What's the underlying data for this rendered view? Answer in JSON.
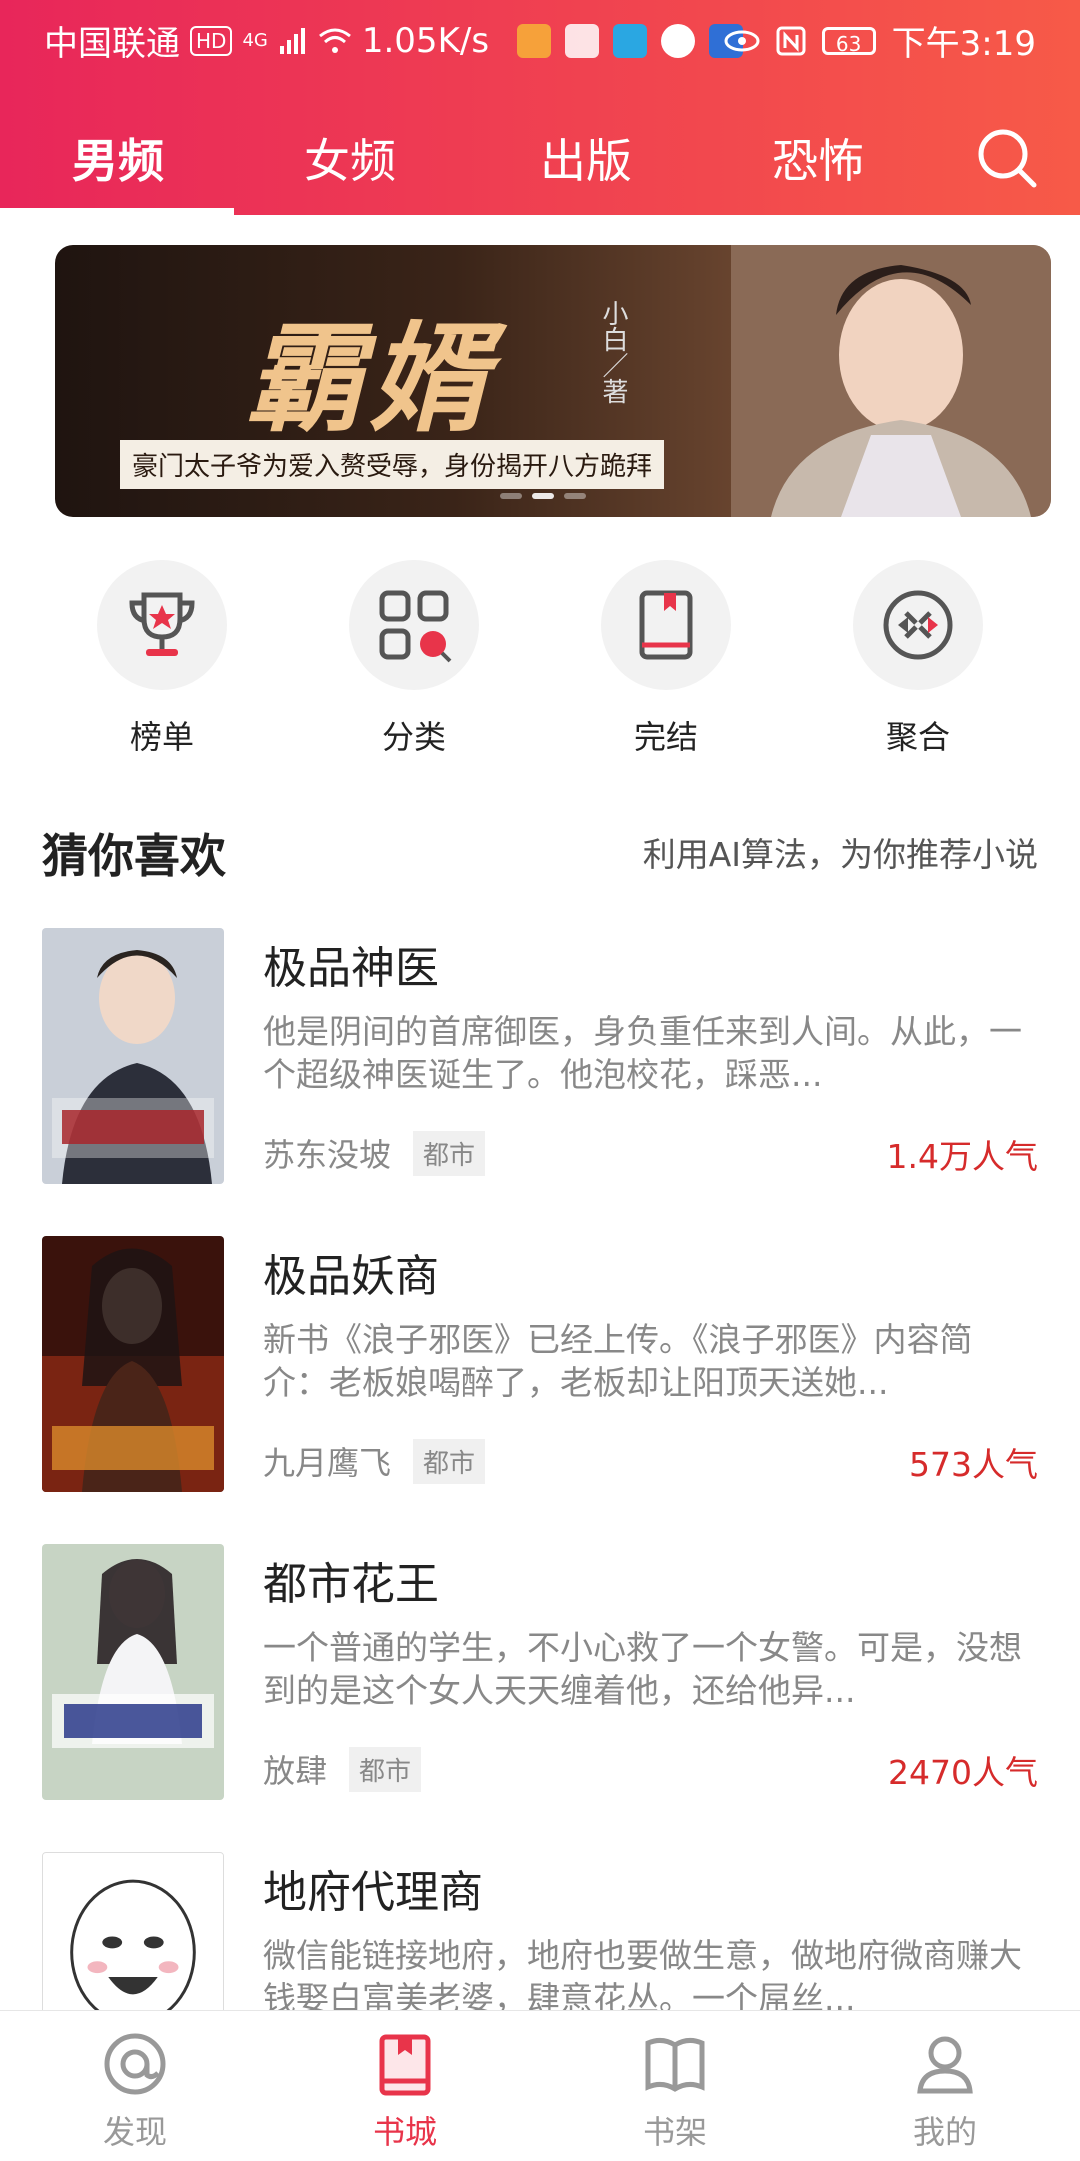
{
  "status_bar": {
    "carrier": "中国联通",
    "hd": "HD",
    "network": "4G",
    "speed": "1.05K/s",
    "battery": "63",
    "time": "下午3:19"
  },
  "tabs": [
    {
      "label": "男频",
      "active": true
    },
    {
      "label": "女频",
      "active": false
    },
    {
      "label": "出版",
      "active": false
    },
    {
      "label": "恐怖",
      "active": false
    }
  ],
  "banner": {
    "title": "霸婿",
    "author": "小白／著",
    "caption": "豪门太子爷为爱入赘受辱，身份揭开八方跪拜",
    "slide_count": 3,
    "active_slide": 2
  },
  "quick_links": [
    {
      "label": "榜单",
      "icon": "trophy-icon"
    },
    {
      "label": "分类",
      "icon": "category-icon"
    },
    {
      "label": "完结",
      "icon": "book-icon"
    },
    {
      "label": "聚合",
      "icon": "aggregate-icon"
    }
  ],
  "section": {
    "title": "猜你喜欢",
    "subtitle": "利用AI算法，为你推荐小说"
  },
  "books": [
    {
      "title": "极品神医",
      "desc": "他是阴间的首席御医，身负重任来到人间。从此，一个超级神医诞生了。他泡校花，踩恶...",
      "author": "苏东没坡",
      "tag": "都市",
      "popularity": "1.4万人气"
    },
    {
      "title": "极品妖商",
      "desc": "新书《浪子邪医》已经上传。《浪子邪医》内容简介：老板娘喝醉了，老板却让阳顶天送她...",
      "author": "九月鹰飞",
      "tag": "都市",
      "popularity": "573人气"
    },
    {
      "title": "都市花王",
      "desc": "一个普通的学生，不小心救了一个女警。可是，没想到的是这个女人天天缠着他，还给他异...",
      "author": "放肆",
      "tag": "都市",
      "popularity": "2470人气"
    },
    {
      "title": "地府代理商",
      "desc": "微信能链接地府，地府也要做生意，做地府微商赚大钱娶白富美老婆，肆意花丛。一个屌丝...",
      "author": "",
      "tag": "",
      "popularity": ""
    }
  ],
  "bottom_nav": [
    {
      "label": "发现",
      "icon": "discover-icon",
      "active": false
    },
    {
      "label": "书城",
      "icon": "bookstore-icon",
      "active": true
    },
    {
      "label": "书架",
      "icon": "bookshelf-icon",
      "active": false
    },
    {
      "label": "我的",
      "icon": "profile-icon",
      "active": false
    }
  ],
  "colors": {
    "accent": "#e8344a",
    "popularity": "#d62b2b"
  }
}
